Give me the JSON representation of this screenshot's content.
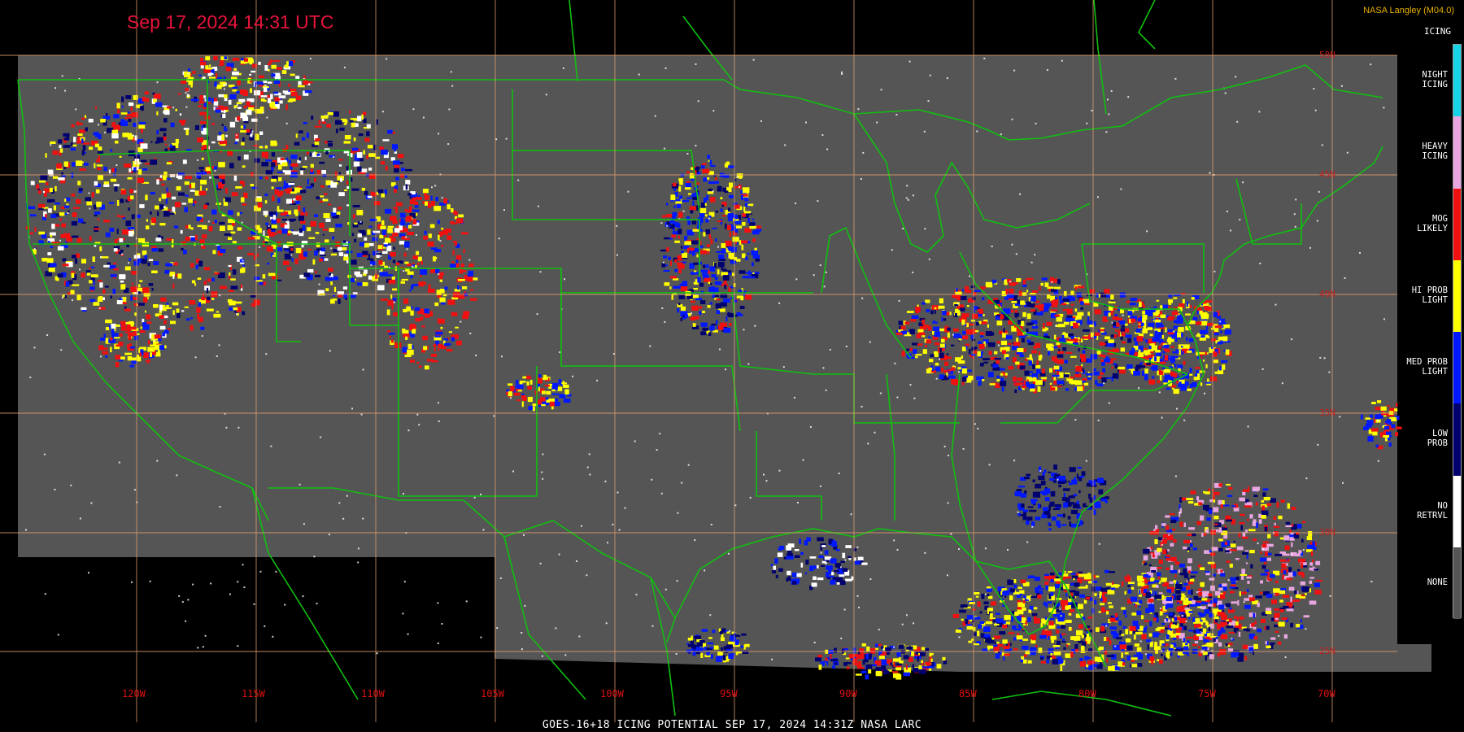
{
  "header": {
    "timestamp": "Sep 17, 2024 14:31 UTC",
    "credit": "NASA Langley (M04.0)"
  },
  "footer": {
    "caption": "GOES-16+18  ICING POTENTIAL   SEP 17, 2024 14:31Z   NASA LARC"
  },
  "legend": {
    "title": "ICING",
    "categories": [
      {
        "label": "NIGHT\nICING",
        "color": "#16d4e6"
      },
      {
        "label": "HEAVY\nICING",
        "color": "#e8a6e0"
      },
      {
        "label": "MOG\nLIKELY",
        "color": "#f01010"
      },
      {
        "label": "HI PROB\nLIGHT",
        "color": "#ffff00"
      },
      {
        "label": "MED PROB\nLIGHT",
        "color": "#0018ff"
      },
      {
        "label": "LOW\nPROB",
        "color": "#00006e"
      },
      {
        "label": "NO\nRETRVL",
        "color": "#ffffff"
      },
      {
        "label": "NONE",
        "color": "#555555"
      }
    ]
  },
  "grid": {
    "longitude_labels": [
      "120W",
      "115W",
      "110W",
      "105W",
      "100W",
      "95W",
      "90W",
      "85W",
      "80W",
      "75W",
      "70W"
    ],
    "latitude_labels": [
      "50N",
      "45N",
      "40N",
      "35N",
      "30N",
      "25N"
    ]
  },
  "colors": {
    "background": "#000000",
    "no_data_fill": "#555555",
    "borders": "#10c010",
    "gridlines": "#e0a070",
    "grid_labels": "#dd1010",
    "timestamp": "#e8143c",
    "credit": "#e8b000"
  }
}
